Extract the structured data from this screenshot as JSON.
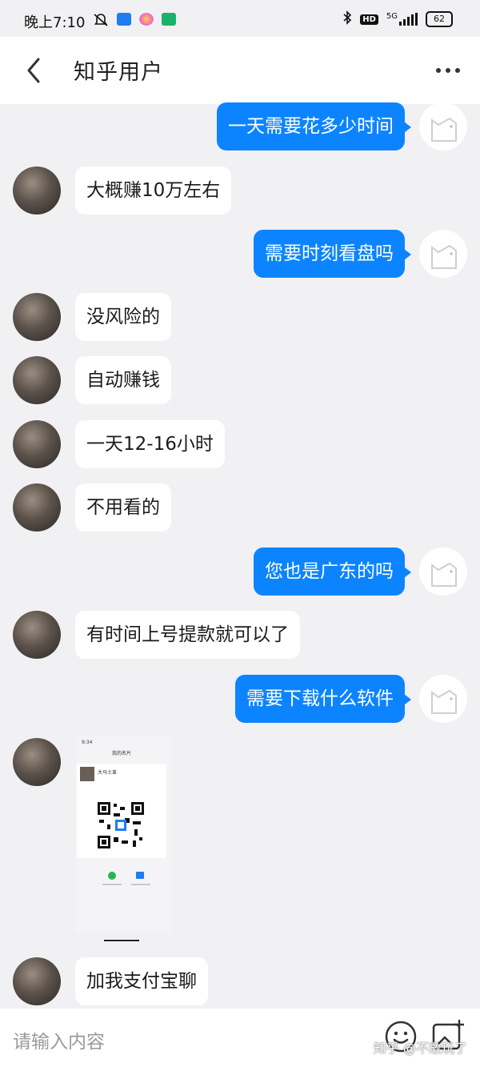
{
  "status_bar": {
    "time": "晚上7:10",
    "network": "5G",
    "battery": "62",
    "hd": "HD"
  },
  "header": {
    "title": "知乎用户"
  },
  "messages": [
    {
      "side": "right",
      "text": "一天需要花多少时间"
    },
    {
      "side": "left",
      "text": "大概赚10万左右"
    },
    {
      "side": "right",
      "text": "需要时刻看盘吗"
    },
    {
      "side": "left",
      "text": "没风险的"
    },
    {
      "side": "left",
      "text": "自动赚钱"
    },
    {
      "side": "left",
      "text": "一天12-16小时"
    },
    {
      "side": "left",
      "text": "不用看的"
    },
    {
      "side": "right",
      "text": "您也是广东的吗"
    },
    {
      "side": "left",
      "text": "有时间上号提款就可以了"
    },
    {
      "side": "right",
      "text": "需要下载什么软件"
    },
    {
      "side": "left",
      "text": "加我支付宝聊"
    }
  ],
  "image_message": {
    "time": "9:34",
    "title": "我的名片",
    "name": "大马士革"
  },
  "input": {
    "placeholder": "请输入内容"
  },
  "watermark": "知乎 @不敢玩了",
  "colors": {
    "accent": "#0d84ff",
    "background": "#f1f1f3"
  }
}
